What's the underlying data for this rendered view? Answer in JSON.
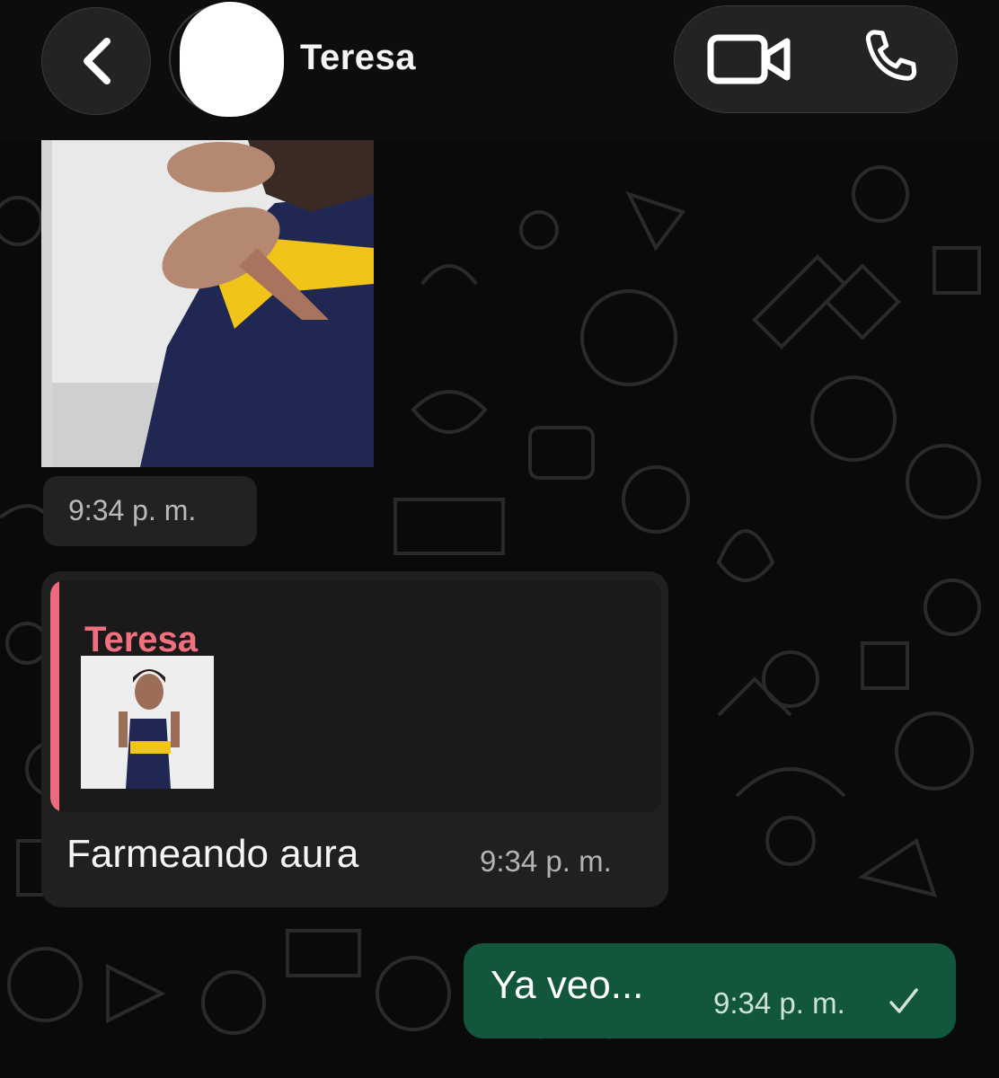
{
  "header": {
    "contact_name": "Teresa",
    "icons": {
      "back": "chevron-left-icon",
      "video": "video-camera-icon",
      "phone": "phone-icon"
    }
  },
  "messages": {
    "photo": {
      "time": "9:34 p. m."
    },
    "reply": {
      "quoted_author": "Teresa",
      "quoted_author_color": "#f0707f",
      "text": "Farmeando  aura",
      "time": "9:34 p. m."
    },
    "sent": {
      "text": "Ya veo...",
      "time": "9:34 p. m.",
      "status_icon": "single-check-icon",
      "bubble_color": "#12563c"
    }
  }
}
